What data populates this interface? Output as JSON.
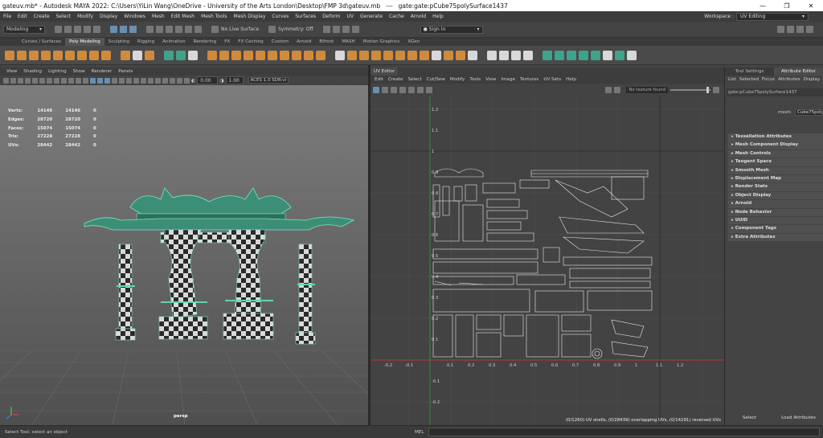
{
  "window": {
    "title": "gateuv.mb* - Autodesk MAYA 2022: C:\\Users\\YiLin Wang\\OneDrive - University of the Arts London\\Desktop\\FMP 3d\\gateuv.mb   ---   gate:gate:pCube75polySurface1437",
    "controls": [
      "—",
      "❐",
      "✕"
    ]
  },
  "menubar": {
    "items": [
      "File",
      "Edit",
      "Create",
      "Select",
      "Modify",
      "Display",
      "Windows",
      "Mesh",
      "Edit Mesh",
      "Mesh Tools",
      "Mesh Display",
      "Curves",
      "Surfaces",
      "Deform",
      "UV",
      "Generate",
      "Cache",
      "Arnold",
      "Help"
    ],
    "workspace_label": "Workspace :",
    "workspace_value": "UV Editing"
  },
  "statusline": {
    "mode": "Modeling",
    "live_surface": "No Live Surface",
    "symmetry": "Symmetry: Off",
    "sign_in": "Sign In"
  },
  "shelf_tabs": {
    "items": [
      "Curves / Surfaces",
      "Poly Modeling",
      "Sculpting",
      "Rigging",
      "Animation",
      "Rendering",
      "FX",
      "FX Caching",
      "Custom",
      "Arnold",
      "Bifrost",
      "MASH",
      "Motion Graphics",
      "XGen"
    ],
    "active": "Poly Modeling"
  },
  "viewport": {
    "menu": [
      "View",
      "Shading",
      "Lighting",
      "Show",
      "Renderer",
      "Panels"
    ],
    "exposure": "0.00",
    "gamma": "1.00",
    "colorspace": "ACES 1.0 SDR-vi",
    "hud": [
      {
        "label": "Verts:",
        "a": "14146",
        "b": "14146",
        "c": "0"
      },
      {
        "label": "Edges:",
        "a": "28720",
        "b": "28720",
        "c": "0"
      },
      {
        "label": "Faces:",
        "a": "15074",
        "b": "15074",
        "c": "0"
      },
      {
        "label": "Tris:",
        "a": "27228",
        "b": "27228",
        "c": "0"
      },
      {
        "label": "UVs:",
        "a": "28442",
        "b": "28442",
        "c": "0"
      }
    ],
    "camera": "persp"
  },
  "uv_editor": {
    "tab": "UV Editor",
    "menu": [
      "Edit",
      "Create",
      "Select",
      "Cut/Sew",
      "Modify",
      "Tools",
      "View",
      "Image",
      "Textures",
      "UV Sets",
      "Help"
    ],
    "no_texture": "No texture found",
    "y_ticks": [
      "1.2",
      "1.1",
      "1",
      "0.9",
      "0.8",
      "0.7",
      "0.6",
      "0.5",
      "0.4",
      "0.3",
      "0.2",
      "0.1",
      "",
      "-0.1",
      "-0.2"
    ],
    "x_ticks": [
      "-0.2",
      "-0.1",
      "",
      "0.1",
      "0.2",
      "0.3",
      "0.4",
      "0.5",
      "0.6",
      "0.7",
      "0.8",
      "0.9",
      "1",
      "1.1",
      "1.2"
    ],
    "status": "(0/1260) UV shells, (0/28439) overlapping UVs, (0/14291) reversed UVs"
  },
  "attribute_editor": {
    "tabs": [
      "Tool Settings",
      "Attribute Editor"
    ],
    "active_tab": "Attribute Editor",
    "menu": [
      "List",
      "Selected",
      "Focus",
      "Attributes",
      "Display"
    ],
    "node_name": "gate:pCube75polySurface1437",
    "mesh_label": "mesh:",
    "mesh_value": "Cube75polySurf",
    "sections": [
      "Tessellation Attributes",
      "Mesh Component Display",
      "Mesh Controls",
      "Tangent Space",
      "Smooth Mesh",
      "Displacement Map",
      "Render Stats",
      "Object Display",
      "Arnold",
      "Node Behavior",
      "UUID",
      "Component Tags",
      "Extra Attributes"
    ],
    "buttons": [
      "Select",
      "Load Attributes"
    ]
  },
  "helpline": {
    "text": "Select Tool: select an object",
    "mel": "MEL"
  },
  "colors": {
    "wire": "#5fd6b0",
    "uv_lines": "#e8e8e8",
    "accent_orange": "#d08a3c"
  }
}
